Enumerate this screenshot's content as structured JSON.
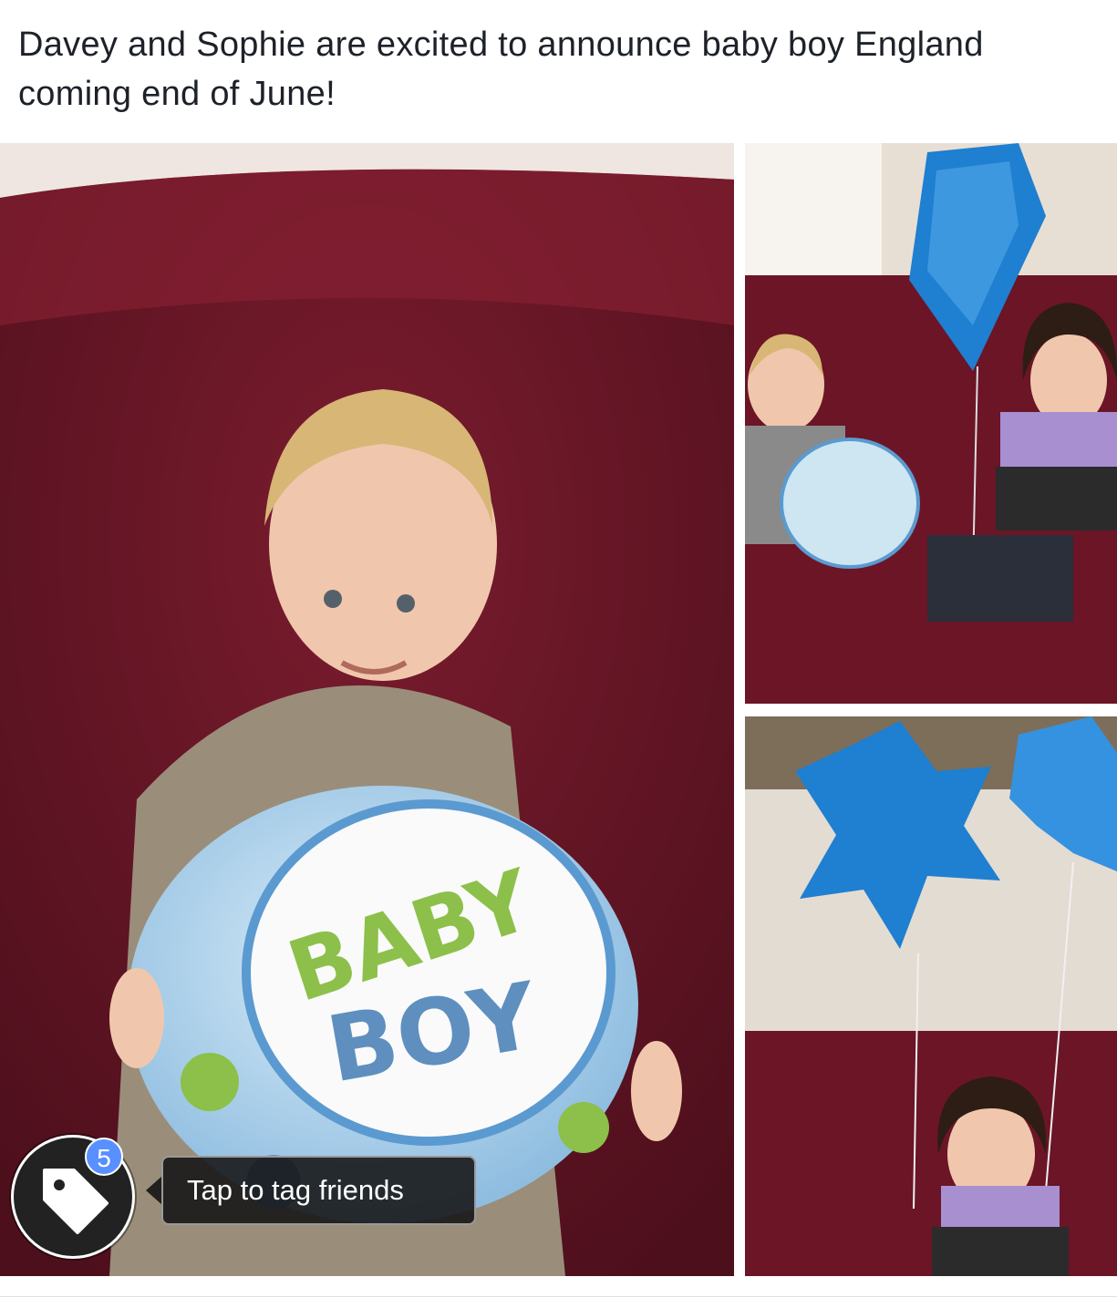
{
  "post": {
    "caption": "Davey and Sophie are excited to announce baby boy England coming end of June!"
  },
  "balloon": {
    "line1": "BABY",
    "line2": "BOY"
  },
  "tagging": {
    "count": "5",
    "tooltip": "Tap to tag friends",
    "icon": "tag-icon"
  },
  "colors": {
    "couch": "#6b1526",
    "badge": "#5890ff",
    "balloon_blue": "#1f7fd0"
  }
}
